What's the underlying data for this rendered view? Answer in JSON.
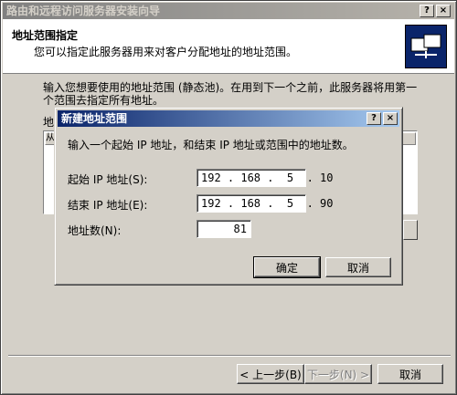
{
  "window": {
    "title": "路由和远程访问服务器安装向导",
    "help_glyph": "?",
    "close_glyph": "×"
  },
  "header": {
    "title": "地址范围指定",
    "subtitle": "您可以指定此服务器用来对客户分配地址的地址范围。",
    "icon": "network-wizard-icon"
  },
  "body": {
    "intro_line1": "输入您想要使用的地址范围 (静态池)。在用到下一个之前，此服务器将用第一",
    "intro_line2": "个范围去指定所有地址。",
    "list_label": "地",
    "list_col1": "从"
  },
  "dialog": {
    "title": "新建地址范围",
    "help_glyph": "?",
    "close_glyph": "×",
    "message": "输入一个起始 IP 地址，和结束 IP 地址或范围中的地址数。",
    "start_label": "起始 IP 地址(S):",
    "start_value": "192 . 168 .  5  . 10",
    "end_label": "结束 IP 地址(E):",
    "end_value": "192 . 168 .  5  . 90",
    "count_label": "地址数(N):",
    "count_value": "81",
    "ok_label": "确定",
    "cancel_label": "取消"
  },
  "footer": {
    "back_label": "< 上一步(B)",
    "next_label": "下一步(N) >",
    "cancel_label": "取消"
  }
}
